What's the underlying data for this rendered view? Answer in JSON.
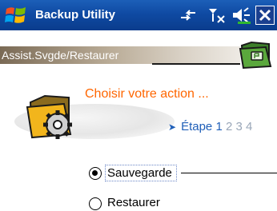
{
  "titlebar": {
    "app_title": "Backup Utility",
    "icons": [
      "windows-start-icon",
      "connectivity-icon",
      "signal-icon",
      "volume-icon",
      "close-icon"
    ]
  },
  "header": {
    "label": "Assist.Svgde/Restaurer",
    "icon": "backup-folder-icon"
  },
  "content": {
    "action_title": "Choisir votre action ...",
    "step": {
      "label": "Étape",
      "current": "1",
      "others": "2 3 4"
    }
  },
  "options": [
    {
      "label": "Sauvegarde",
      "selected": true
    },
    {
      "label": "Restaurer",
      "selected": false
    }
  ],
  "colors": {
    "titlebar": "#0f4aa3",
    "accent_orange": "#ff6600",
    "step_blue": "#1f5fb8",
    "step_grey": "#9aa7b8"
  }
}
